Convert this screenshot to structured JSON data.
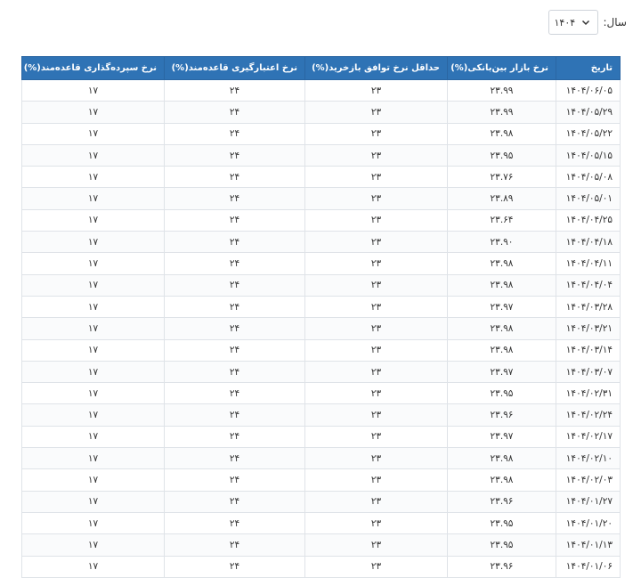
{
  "filter": {
    "year_label": "سال:",
    "year_value": "۱۴۰۴"
  },
  "table": {
    "headers": [
      "تاریخ",
      "نرخ بازار بین‌بانکی(%)",
      "حداقل نرخ توافق بازخرید(%)",
      "نرخ اعتبارگیری قاعده‌مند(%)",
      "نرخ سپرده‌گذاری قاعده‌مند(%)"
    ],
    "rows": [
      [
        "۱۴۰۴/۰۶/۰۵",
        "۲۳.۹۹",
        "۲۳",
        "۲۴",
        "۱۷"
      ],
      [
        "۱۴۰۴/۰۵/۲۹",
        "۲۳.۹۹",
        "۲۳",
        "۲۴",
        "۱۷"
      ],
      [
        "۱۴۰۴/۰۵/۲۲",
        "۲۳.۹۸",
        "۲۳",
        "۲۴",
        "۱۷"
      ],
      [
        "۱۴۰۴/۰۵/۱۵",
        "۲۳.۹۵",
        "۲۳",
        "۲۴",
        "۱۷"
      ],
      [
        "۱۴۰۴/۰۵/۰۸",
        "۲۳.۷۶",
        "۲۳",
        "۲۴",
        "۱۷"
      ],
      [
        "۱۴۰۴/۰۵/۰۱",
        "۲۳.۸۹",
        "۲۳",
        "۲۴",
        "۱۷"
      ],
      [
        "۱۴۰۴/۰۴/۲۵",
        "۲۳.۶۴",
        "۲۳",
        "۲۴",
        "۱۷"
      ],
      [
        "۱۴۰۴/۰۴/۱۸",
        "۲۳.۹۰",
        "۲۳",
        "۲۴",
        "۱۷"
      ],
      [
        "۱۴۰۴/۰۴/۱۱",
        "۲۳.۹۸",
        "۲۳",
        "۲۴",
        "۱۷"
      ],
      [
        "۱۴۰۴/۰۴/۰۴",
        "۲۳.۹۸",
        "۲۳",
        "۲۴",
        "۱۷"
      ],
      [
        "۱۴۰۴/۰۳/۲۸",
        "۲۳.۹۷",
        "۲۳",
        "۲۴",
        "۱۷"
      ],
      [
        "۱۴۰۴/۰۳/۲۱",
        "۲۳.۹۸",
        "۲۳",
        "۲۴",
        "۱۷"
      ],
      [
        "۱۴۰۴/۰۳/۱۴",
        "۲۳.۹۸",
        "۲۳",
        "۲۴",
        "۱۷"
      ],
      [
        "۱۴۰۴/۰۳/۰۷",
        "۲۳.۹۷",
        "۲۳",
        "۲۴",
        "۱۷"
      ],
      [
        "۱۴۰۴/۰۲/۳۱",
        "۲۳.۹۵",
        "۲۳",
        "۲۴",
        "۱۷"
      ],
      [
        "۱۴۰۴/۰۲/۲۴",
        "۲۳.۹۶",
        "۲۳",
        "۲۴",
        "۱۷"
      ],
      [
        "۱۴۰۴/۰۲/۱۷",
        "۲۳.۹۷",
        "۲۳",
        "۲۴",
        "۱۷"
      ],
      [
        "۱۴۰۴/۰۲/۱۰",
        "۲۳.۹۸",
        "۲۳",
        "۲۴",
        "۱۷"
      ],
      [
        "۱۴۰۴/۰۲/۰۳",
        "۲۳.۹۸",
        "۲۳",
        "۲۴",
        "۱۷"
      ],
      [
        "۱۴۰۴/۰۱/۲۷",
        "۲۳.۹۶",
        "۲۳",
        "۲۴",
        "۱۷"
      ],
      [
        "۱۴۰۴/۰۱/۲۰",
        "۲۳.۹۵",
        "۲۳",
        "۲۴",
        "۱۷"
      ],
      [
        "۱۴۰۴/۰۱/۱۳",
        "۲۳.۹۵",
        "۲۳",
        "۲۴",
        "۱۷"
      ],
      [
        "۱۴۰۴/۰۱/۰۶",
        "۲۳.۹۶",
        "۲۳",
        "۲۴",
        "۱۷"
      ]
    ]
  },
  "colors": {
    "header_bg": "#2f73b5",
    "header_text": "#ffffff",
    "border": "#dfe3e8"
  },
  "icons": {
    "select_arrow": "chevron-down-icon"
  }
}
